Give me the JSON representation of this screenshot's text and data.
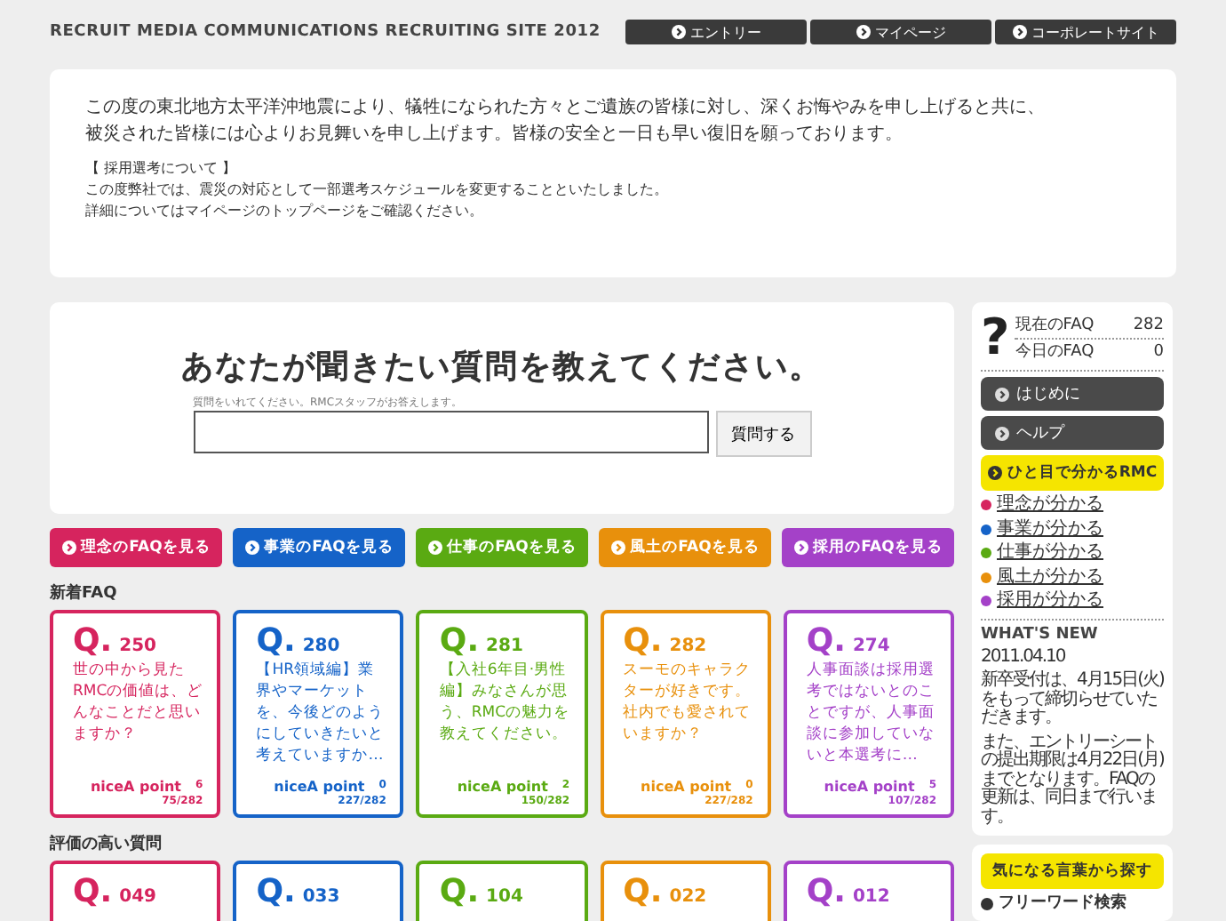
{
  "header": {
    "site_title": "RECRUIT MEDIA COMMUNICATIONS RECRUITING SITE 2012",
    "nav": [
      "エントリー",
      "マイページ",
      "コーポレートサイト"
    ]
  },
  "notice": {
    "lead": [
      "この度の東北地方太平洋沖地震により、犠牲になられた方々とご遺族の皆様に対し、深くお悔やみを申し上げると共に、",
      "被災された皆様には心よりお見舞いを申し上げます。皆様の安全と一日も早い復旧を願っております。"
    ],
    "heading": "【 採用選考について 】",
    "body": [
      "この度弊社では、震災の対応として一部選考スケジュールを変更することといたしました。",
      "詳細についてはマイページのトップページをご確認ください。"
    ]
  },
  "ask": {
    "title": "あなたが聞きたい質問を教えてください。",
    "hint": "質問をいれてください。RMCスタッフがお答えします。",
    "button": "質問する"
  },
  "categories": [
    {
      "label": "理念のFAQを見る",
      "color": "#d6245e"
    },
    {
      "label": "事業のFAQを見る",
      "color": "#1563c8"
    },
    {
      "label": "仕事のFAQを見る",
      "color": "#5aaa12"
    },
    {
      "label": "風土のFAQを見る",
      "color": "#e8900c"
    },
    {
      "label": "採用のFAQを見る",
      "color": "#a441c8"
    }
  ],
  "sections": [
    {
      "title": "新着FAQ",
      "cards": [
        {
          "q_mark": "Q.",
          "number": "250",
          "text": "世の中から見たRMCの価値は、どんなことだと思いますか？",
          "nice_label": "niceA point",
          "nice_count": "6",
          "rank": "75/282",
          "color": "#d6245e"
        },
        {
          "q_mark": "Q.",
          "number": "280",
          "text": "【HR領域編】業界やマーケットを、今後どのようにしていきたいと考えていますか…",
          "nice_label": "niceA point",
          "nice_count": "0",
          "rank": "227/282",
          "color": "#1563c8"
        },
        {
          "q_mark": "Q.",
          "number": "281",
          "text": "【入社6年目·男性編】みなさんが思う、RMCの魅力を教えてください。",
          "nice_label": "niceA point",
          "nice_count": "2",
          "rank": "150/282",
          "color": "#5aaa12"
        },
        {
          "q_mark": "Q.",
          "number": "282",
          "text": "スーモのキャラクターが好きです。社内でも愛されていますか？",
          "nice_label": "niceA point",
          "nice_count": "0",
          "rank": "227/282",
          "color": "#e8900c"
        },
        {
          "q_mark": "Q.",
          "number": "274",
          "text": "人事面談は採用選考ではないとのことですが、人事面談に参加していないと本選考に…",
          "nice_label": "niceA point",
          "nice_count": "5",
          "rank": "107/282",
          "color": "#a441c8"
        }
      ]
    },
    {
      "title": "評価の高い質問",
      "cards": [
        {
          "q_mark": "Q.",
          "number": "049",
          "color": "#d6245e"
        },
        {
          "q_mark": "Q.",
          "number": "033",
          "color": "#1563c8"
        },
        {
          "q_mark": "Q.",
          "number": "104",
          "color": "#5aaa12"
        },
        {
          "q_mark": "Q.",
          "number": "022",
          "color": "#e8900c"
        },
        {
          "q_mark": "Q.",
          "number": "012",
          "color": "#a441c8"
        }
      ]
    }
  ],
  "sidebar": {
    "stats_icon": "?",
    "stats": [
      {
        "label": "現在のFAQ",
        "value": "282"
      },
      {
        "label": "今日のFAQ",
        "value": "0"
      }
    ],
    "buttons": [
      "はじめに",
      "ヘルプ"
    ],
    "overview": "ひと目で分かるRMC",
    "links": [
      {
        "label": "理念が分かる",
        "color": "#d6245e"
      },
      {
        "label": "事業が分かる",
        "color": "#1563c8"
      },
      {
        "label": "仕事が分かる",
        "color": "#5aaa12"
      },
      {
        "label": "風土が分かる",
        "color": "#e8900c"
      },
      {
        "label": "採用が分かる",
        "color": "#a441c8"
      }
    ],
    "news_title": "WHAT'S NEW",
    "news": [
      "2011.04.10",
      "新卒受付は、4月15日(火)をもって締切らせていただきます。",
      "また、エントリーシートの提出期限は4月22日(月)までとなります。FAQの更新は、同日まで行います。"
    ],
    "search_title": "気になる言葉から探す",
    "freeword": "フリーワード検索"
  }
}
